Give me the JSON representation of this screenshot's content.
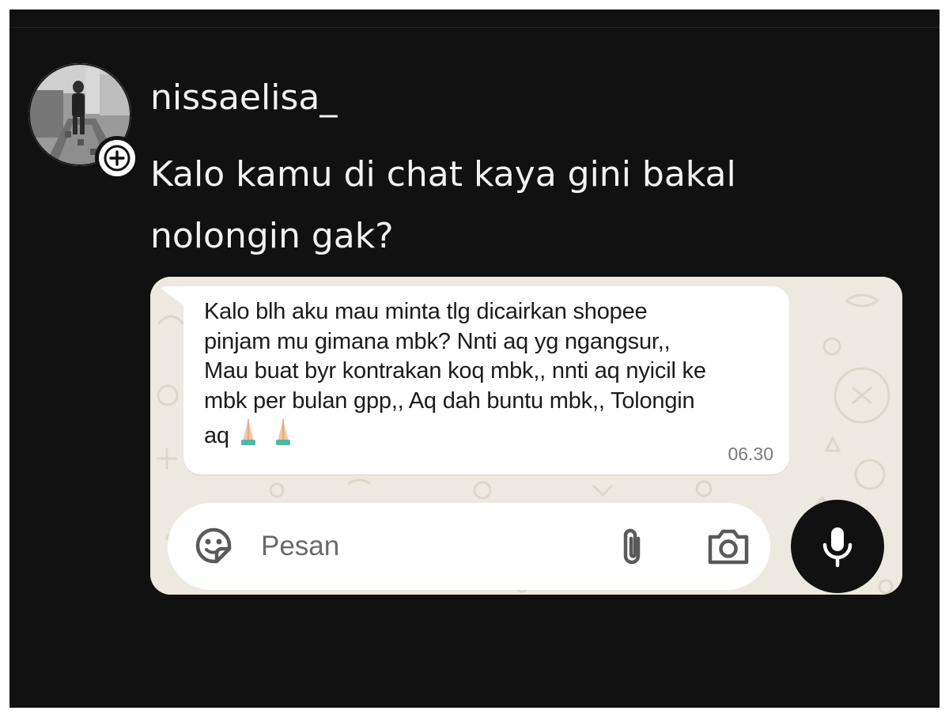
{
  "post": {
    "username": "nissaelisa_",
    "caption": "Kalo kamu di chat kaya gini bakal nolongin gak?",
    "avatar_icon": "profile-photo",
    "badge_icon": "plus-icon"
  },
  "chat": {
    "message_lines": [
      "Kalo blh aku mau minta tlg dicairkan shopee",
      "pinjam mu gimana mbk? Nnti aq yg ngangsur,,",
      "Mau buat byr kontrakan koq mbk,, nnti aq nyicil ke",
      "mbk per bulan gpp,, Aq dah buntu mbk,, Tolongin",
      "aq"
    ],
    "emoji": "🙏🏻 🙏🏻",
    "time": "06.30",
    "input_placeholder": "Pesan",
    "icons": [
      "sticker-icon",
      "paperclip-icon",
      "camera-icon",
      "microphone-icon"
    ]
  },
  "colors": {
    "background": "#111111",
    "chat_wallpaper": "#eee9e0",
    "bubble": "#ffffff",
    "text_light": "#f2f2f2",
    "time": "#7a7a7a"
  }
}
